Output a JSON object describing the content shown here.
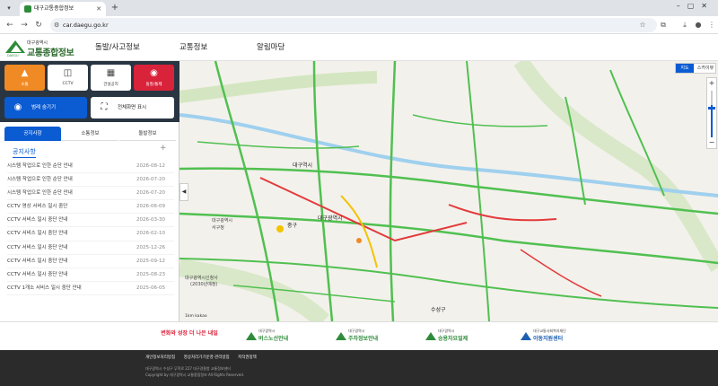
{
  "browser": {
    "tab_title": "대구교통종합정보",
    "url": "car.daegu.go.kr"
  },
  "header": {
    "logo_top": "대구광역시",
    "logo_main": "교통종합정보",
    "logo_sub": "DAEGU",
    "nav": [
      "돌발/사고정보",
      "교통정보",
      "알림마당"
    ]
  },
  "quick_buttons": [
    {
      "label": "소통",
      "icon": "traffic-cone-icon"
    },
    {
      "label": "CCTV",
      "icon": "cctv-icon"
    },
    {
      "label": "건설공지",
      "icon": "construction-icon"
    },
    {
      "label": "돌발/통제",
      "icon": "alert-icon"
    }
  ],
  "actions": {
    "legend_toggle": "범례 숨기기",
    "fullscreen": "전체화면 표시"
  },
  "panel_tabs": [
    "공지사항",
    "소통정보",
    "돌발정보"
  ],
  "notice": {
    "heading": "공지사항",
    "items": [
      {
        "title": "시스템 작업으로 인한 순단 안내",
        "date": "2026-08-12"
      },
      {
        "title": "시스템 작업으로 인한 순단 안내",
        "date": "2026-07-20"
      },
      {
        "title": "시스템 작업으로 인한 순단 안내",
        "date": "2026-07-20"
      },
      {
        "title": "CCTV 영상 서비스 일시 중단",
        "date": "2026-06-09"
      },
      {
        "title": "CCTV 서비스 일시 중단 안내",
        "date": "2026-03-30"
      },
      {
        "title": "CCTV 서비스 일시 중단 안내",
        "date": "2026-02-10"
      },
      {
        "title": "CCTV 서비스 일시 중단 안내",
        "date": "2025-12-26"
      },
      {
        "title": "CCTV 서비스 일시 중단 안내",
        "date": "2025-09-12"
      },
      {
        "title": "CCTV 서비스 일시 중단 안내",
        "date": "2025-08-23"
      },
      {
        "title": "CCTV 1개소 서비스 일시 중단 안내",
        "date": "2025-06-05"
      }
    ]
  },
  "map": {
    "type_map": "지도",
    "type_sky": "스카이뷰",
    "labels": [
      {
        "text": "대구역시",
        "name": "label-daegu-station"
      },
      {
        "text": "중구",
        "name": "label-jung-gu"
      },
      {
        "text": "대구광역시",
        "name": "label-daegu-city"
      },
      {
        "text": "수성구",
        "name": "label-suseong-gu"
      },
      {
        "text": "대구광역시신청사",
        "name": "label-new-city-hall"
      },
      {
        "text": "(2030년예정)",
        "name": "label-new-city-hall-year"
      },
      {
        "text": "대구광역시",
        "name": "label-seo-gu-1"
      },
      {
        "text": "서구청",
        "name": "label-seo-gu-2"
      }
    ],
    "scale": "1km kakao"
  },
  "banners": [
    {
      "t1": "",
      "t2": "변화와 성장 더 나은 내일",
      "color": "#d9233a"
    },
    {
      "t1": "대구광역시",
      "t2": "버스노선안내",
      "color": "#2e8b3a"
    },
    {
      "t1": "대구광역시",
      "t2": "주차정보안내",
      "color": "#2e8b3a"
    },
    {
      "t1": "대구광역시",
      "t2": "승용차요일제",
      "color": "#2e8b3a"
    },
    {
      "t1": "대구교통사회복지재단",
      "t2": "이동지원센터",
      "color": "#1d5fb0"
    }
  ],
  "footer": {
    "links": [
      "개인정보처리방침",
      "영상처리기기운영·관리방침",
      "저작권정책"
    ],
    "address": "대구광역시 수성구 무학로 227 대구경찰청 교통정보센터",
    "copyright": "Copyright by 대구광역시 교통종합정보 All Rights Reserved."
  }
}
